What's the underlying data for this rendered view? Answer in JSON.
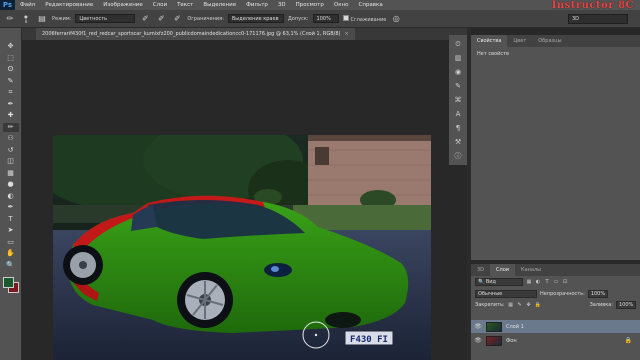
{
  "app": {
    "logo": "Ps"
  },
  "menu": [
    "Файл",
    "Редактирование",
    "Изображение",
    "Слои",
    "Текст",
    "Выделение",
    "Фильтр",
    "3D",
    "Просмотр",
    "Окно",
    "Справка"
  ],
  "watermark": "Instructor 8C",
  "options": {
    "brush_size": "8",
    "mode_label": "Режим:",
    "mode_value": "Цветность",
    "refine_label": "Ограничения:",
    "refine_value": "Выделение краев",
    "tolerance_label": "Допуск:",
    "tolerance_value": "100%",
    "antialias_label": "Сглаживание",
    "workspace": "3D"
  },
  "document": {
    "tab_title": "2006ferrarif430f1_red_redcar_sportscar_kumixfz200_publicdomaindedicationcc0-171176.jpg @ 63,1% (Слой 1, RGB/8)",
    "close": "×"
  },
  "toolbar": {
    "tools": [
      "move-tool-icon",
      "marquee-tool-icon",
      "lasso-tool-icon",
      "quick-select-icon",
      "crop-tool-icon",
      "eyedropper-icon",
      "healing-brush-icon",
      "brush-tool-icon",
      "clone-stamp-icon",
      "history-brush-icon",
      "eraser-icon",
      "gradient-icon",
      "blur-icon",
      "dodge-icon",
      "pen-icon",
      "type-icon",
      "path-select-icon",
      "shape-icon",
      "hand-icon",
      "zoom-icon"
    ],
    "glyphs": [
      "✥",
      "⬚",
      "ʘ",
      "✎",
      "⌗",
      "✒",
      "✚",
      "✏",
      "⚇",
      "↺",
      "◫",
      "▦",
      "●",
      "◐",
      "✒",
      "T",
      "➤",
      "▭",
      "✋",
      "🔍"
    ],
    "foreground_color": "#1a5a2a",
    "background_color": "#7a1a1a"
  },
  "properties_panel": {
    "tabs": [
      "Свойства",
      "Цвет",
      "Образцы"
    ],
    "body": "Нет свойств"
  },
  "layers_panel": {
    "tabs": [
      "3D",
      "Слои",
      "Каналы"
    ],
    "kind_filter": "Вид",
    "blend_mode": "Обычные",
    "opacity_label": "Непрозрачность:",
    "opacity_value": "100%",
    "lock_label": "Закрепить:",
    "fill_label": "Заливка:",
    "fill_value": "100%",
    "layers": [
      {
        "name": "Слой 1",
        "selected": true
      },
      {
        "name": "Фон",
        "selected": false
      }
    ]
  },
  "colors": {
    "accent_selection": "#6a7a8c",
    "car_green": "#2f8a12",
    "car_red": "#c21818"
  }
}
